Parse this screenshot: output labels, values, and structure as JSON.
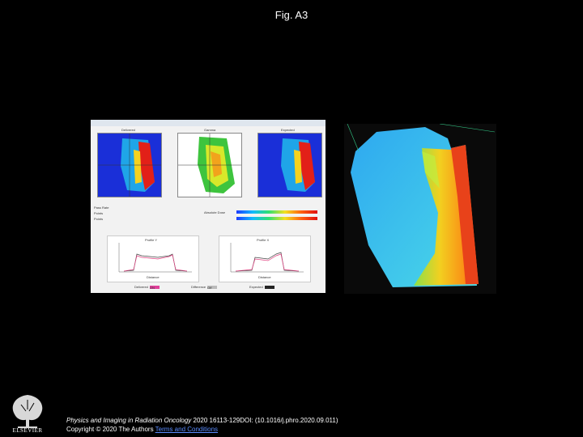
{
  "figure": {
    "title": "Fig. A3"
  },
  "left_panel": {
    "map_labels": [
      "Delivered",
      "Gamma",
      "Expected"
    ],
    "profiles": [
      "Profile Y",
      "Profile X"
    ],
    "profile_xlabel": "Distance",
    "toggles": [
      {
        "label": "Delivered",
        "state": "ON"
      },
      {
        "label": "Difference",
        "state": "Off"
      },
      {
        "label": "Expected",
        "state": "ON"
      }
    ],
    "stats_labels": [
      "Pass Rate",
      "Points",
      "Points"
    ],
    "legend_label": "Absolute Dose"
  },
  "footer": {
    "journal": "Physics and Imaging in Radiation Oncology",
    "citation": " 2020 16113-129DOI: (10.1016/j.phro.2020.09.011)",
    "copyright": "Copyright © 2020 The Authors",
    "link_text": "Terms and Conditions"
  },
  "publisher": {
    "logo_text": "ELSEVIER",
    "logo_icon": "elsevier-tree-icon"
  },
  "colors": {
    "background": "#000000",
    "link": "#5a8cff"
  }
}
